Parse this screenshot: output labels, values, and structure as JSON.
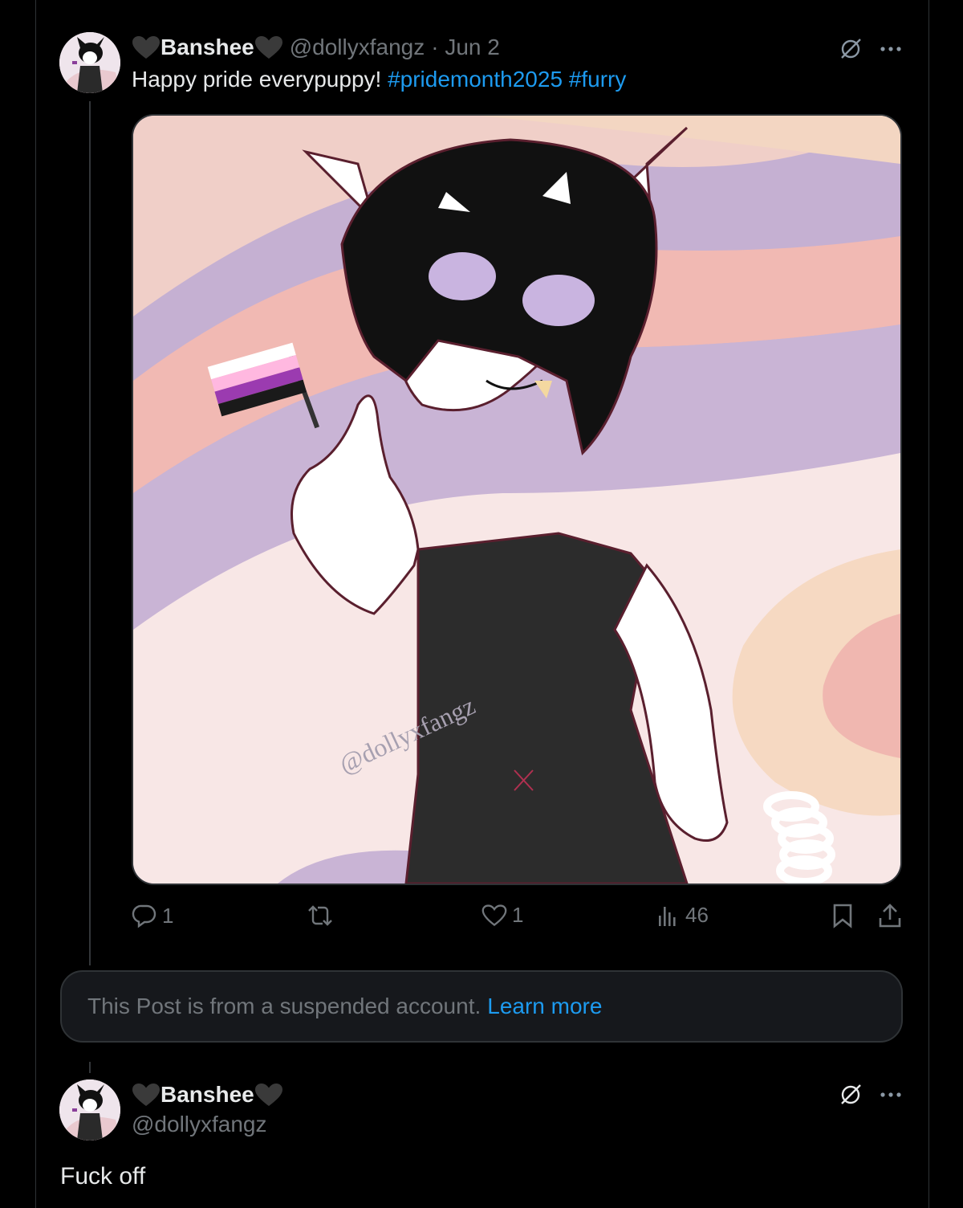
{
  "post": {
    "display_name": "Banshee",
    "handle": "@dollyxfangz",
    "date": "· Jun 2",
    "text": "Happy pride everypuppy!",
    "hashtags": [
      "#pridemonth2025",
      "#furry"
    ],
    "image_watermark": "@dollyxfangz",
    "actions": {
      "reply_count": "1",
      "repost_count": "",
      "like_count": "1",
      "views_count": "46"
    }
  },
  "notice": {
    "text": "This Post is from a suspended account.",
    "link": "Learn more"
  },
  "reply": {
    "display_name": "Banshee",
    "handle": "@dollyxfangz",
    "text": "Fuck off"
  },
  "icons": {
    "name_decoration": "black-heart-icon",
    "grok": "grok-icon",
    "more": "more-icon",
    "reply": "reply-icon",
    "repost": "repost-icon",
    "like": "like-icon",
    "views": "views-icon",
    "bookmark": "bookmark-icon",
    "share": "share-icon"
  },
  "colors": {
    "background": "#000000",
    "text": "#e7e9ea",
    "muted": "#71767b",
    "link": "#1d9bf0",
    "notice_bg": "#16181c",
    "border": "#2f3336"
  }
}
